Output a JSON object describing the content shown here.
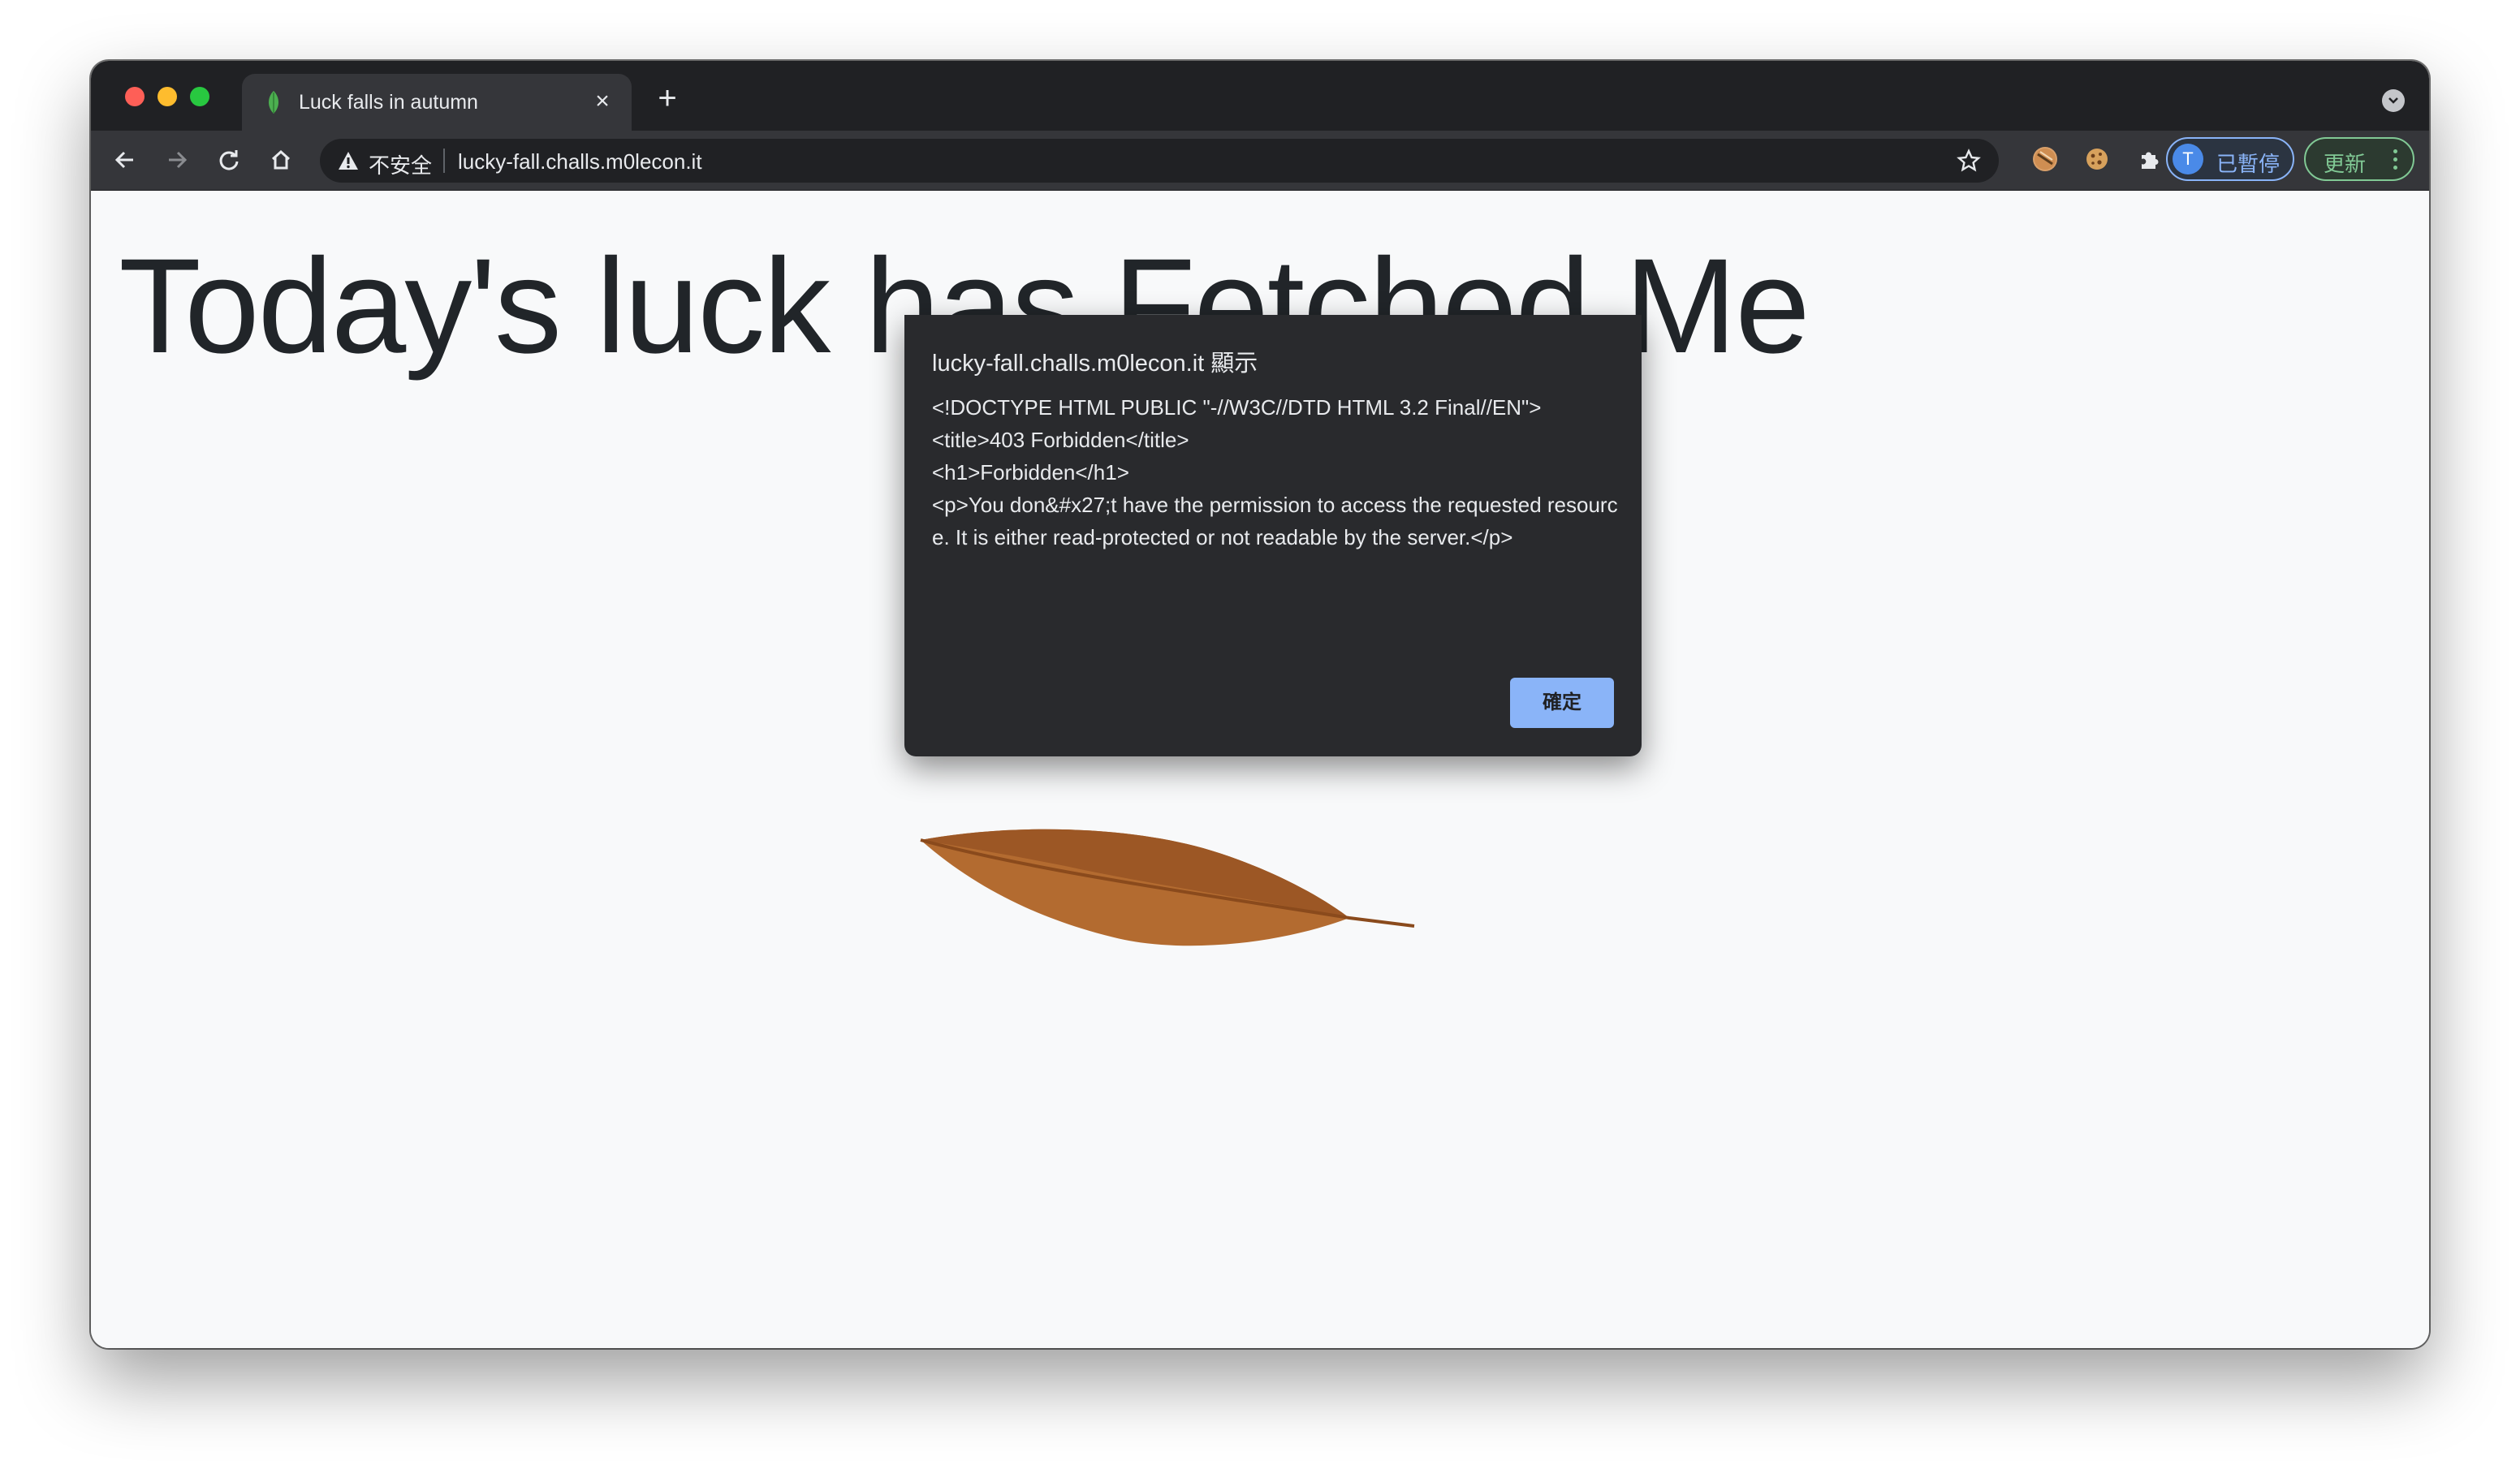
{
  "browser": {
    "tab": {
      "title": "Luck falls in autumn",
      "close_glyph": "×"
    },
    "new_tab_glyph": "+",
    "omnibox": {
      "security_label": "不安全",
      "url": "lucky-fall.challs.m0lecon.it"
    },
    "profile": {
      "initial": "T",
      "status": "已暫停"
    },
    "update_label": "更新"
  },
  "page": {
    "heading": "Today's luck has Fetched Me"
  },
  "dialog": {
    "title": "lucky-fall.challs.m0lecon.it 顯示",
    "message": "<!DOCTYPE HTML PUBLIC \"-//W3C//DTD HTML 3.2 Final//EN\">\n<title>403 Forbidden</title>\n<h1>Forbidden</h1>\n<p>You don&#x27;t have the permission to access the requested resource. It is either read-protected or not readable by the server.</p>",
    "ok_label": "確定"
  },
  "colors": {
    "accent_blue": "#8ab4f8",
    "update_green": "#81c995",
    "leaf_brown": "#b0692e",
    "button_brown": "#a0531c"
  },
  "icons": [
    "back-arrow-icon",
    "forward-arrow-icon",
    "reload-icon",
    "home-icon",
    "warning-icon",
    "star-icon",
    "extension-icon",
    "cookie-icon",
    "puzzle-icon",
    "leaf-favicon-icon",
    "tab-search-icon"
  ]
}
